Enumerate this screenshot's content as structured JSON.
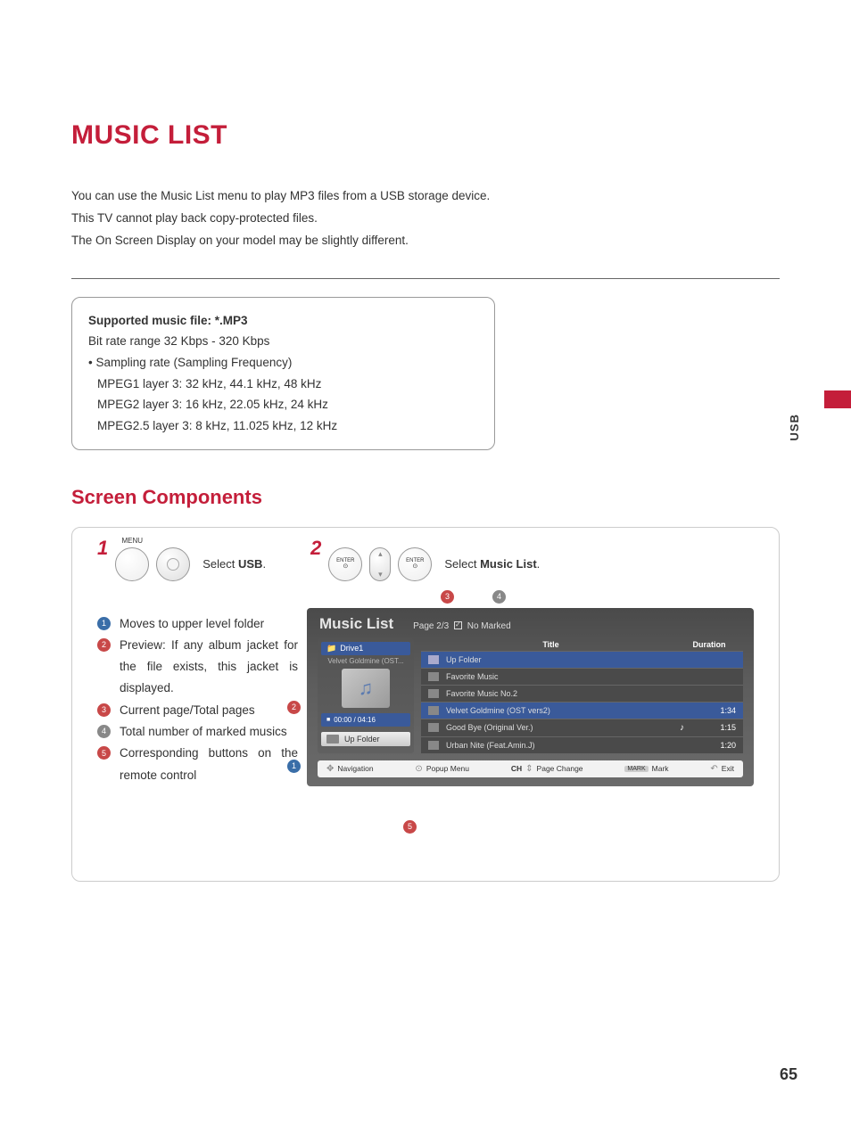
{
  "title": "MUSIC LIST",
  "intro": {
    "line1": "You can use the Music List menu to play MP3 files from a USB storage device.",
    "line2": "This TV cannot play back copy-protected files.",
    "line3": "The On Screen Display on your model may be slightly different."
  },
  "support": {
    "file_title": "Supported music file: *.MP3",
    "bitrate": "Bit rate range 32 Kbps - 320 Kbps",
    "sampling_label": "• Sampling rate (Sampling Frequency)",
    "mpeg1": "MPEG1 layer 3: 32 kHz, 44.1 kHz, 48 kHz",
    "mpeg2": "MPEG2 layer 3: 16 kHz, 22.05  kHz, 24 kHz",
    "mpeg25": "MPEG2.5 layer 3: 8 kHz, 11.025 kHz, 12 kHz"
  },
  "subtitle": "Screen Components",
  "steps": {
    "num1": "1",
    "num2": "2",
    "menu_label": "MENU",
    "enter_label": "ENTER",
    "step1_pre": "Select ",
    "step1_bold": "USB",
    "step1_post": ".",
    "step2_pre": "Select ",
    "step2_bold": "Music List",
    "step2_post": "."
  },
  "legend": {
    "i1": "1",
    "t1": "Moves to upper level folder",
    "i2": "2",
    "t2": "Preview: If any album jacket for the file exists, this jacket is displayed.",
    "i3": "3",
    "t3": "Current page/Total pages",
    "i4": "4",
    "t4": "Total number of marked musics",
    "i5": "5",
    "t5": "Corresponding buttons on the remote control"
  },
  "osd": {
    "title": "Music List",
    "page": "Page 2/3",
    "no_marked": "No Marked",
    "drive": "Drive1",
    "album_name": "Velvet Goldmine (OST...",
    "time": "00:00 / 04:16",
    "up_folder": "Up Folder",
    "col_title": "Title",
    "col_duration": "Duration",
    "rows": {
      "r0": {
        "title": "Up Folder",
        "dur": ""
      },
      "r1": {
        "title": "Favorite Music",
        "dur": ""
      },
      "r2": {
        "title": "Favorite Music No.2",
        "dur": ""
      },
      "r3": {
        "title": "Velvet Goldmine (OST vers2)",
        "dur": "1:34"
      },
      "r4": {
        "title": "Good Bye (Original Ver.)",
        "dur": "1:15"
      },
      "r5": {
        "title": "Urban Nite (Feat.Amin.J)",
        "dur": "1:20"
      }
    },
    "footer": {
      "nav": "Navigation",
      "popup": "Popup Menu",
      "ch": "CH",
      "page_change": "Page Change",
      "mark_key": "MARK",
      "mark": "Mark",
      "exit": "Exit"
    }
  },
  "callouts": {
    "c1": "1",
    "c2": "2",
    "c3": "3",
    "c4": "4",
    "c5": "5"
  },
  "side_label": "USB",
  "page_number": "65"
}
